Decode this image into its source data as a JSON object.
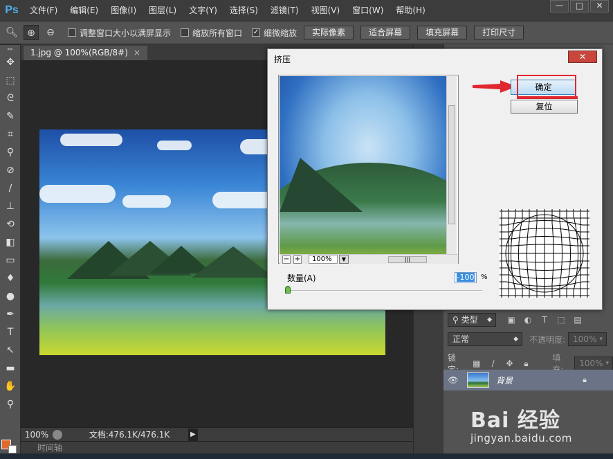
{
  "app": {
    "logo": "Ps"
  },
  "menu": [
    "文件(F)",
    "编辑(E)",
    "图像(I)",
    "图层(L)",
    "文字(Y)",
    "选择(S)",
    "滤镜(T)",
    "视图(V)",
    "窗口(W)",
    "帮助(H)"
  ],
  "window_controls": {
    "minimize": "—",
    "restore": "□",
    "close": "✕"
  },
  "options": {
    "checks": [
      {
        "label": "调整窗口大小以满屏显示",
        "checked": false
      },
      {
        "label": "缩放所有窗口",
        "checked": false
      },
      {
        "label": "细微缩放",
        "checked": true
      }
    ],
    "buttons": [
      "实际像素",
      "适合屏幕",
      "填充屏幕",
      "打印尺寸"
    ]
  },
  "document": {
    "tab_title": "1.jpg @ 100%(RGB/8#)",
    "tab_close": "×",
    "zoom": "100%",
    "doc_size": "文档:476.1K/476.1K",
    "timeline": "时间轴"
  },
  "layers": {
    "filter_kind": "类型",
    "blend_mode": "正常",
    "opacity_label": "不透明度:",
    "opacity_value": "100%",
    "lock_label": "锁定:",
    "fill_label": "填充:",
    "fill_value": "100%",
    "layer_name": "背景"
  },
  "dialog": {
    "title": "挤压",
    "close": "✕",
    "ok": "确定",
    "reset": "复位",
    "preview_zoom": "100%",
    "zoom_out": "−",
    "zoom_in": "+",
    "amount_label": "数量(A)",
    "amount_value": "-100",
    "amount_unit": "%"
  },
  "watermark": {
    "main": "Bai 经验",
    "sub": "jingyan.baidu.com"
  },
  "colors": {
    "foreground": "#e06a2e",
    "background": "#ffffff",
    "highlight": "#e0262e"
  }
}
